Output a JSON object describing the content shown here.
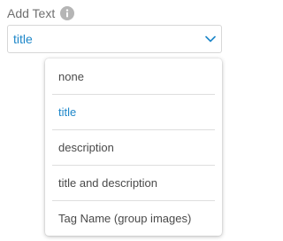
{
  "field": {
    "label": "Add Text",
    "info_icon": "info-icon"
  },
  "select": {
    "value": "title",
    "chevron_icon": "chevron-down-icon",
    "accent_color": "#1e87c9"
  },
  "dropdown": {
    "options": [
      {
        "label": "none",
        "selected": false
      },
      {
        "label": "title",
        "selected": true
      },
      {
        "label": "description",
        "selected": false
      },
      {
        "label": "title and description",
        "selected": false
      },
      {
        "label": "Tag Name (group images)",
        "selected": false
      }
    ]
  }
}
